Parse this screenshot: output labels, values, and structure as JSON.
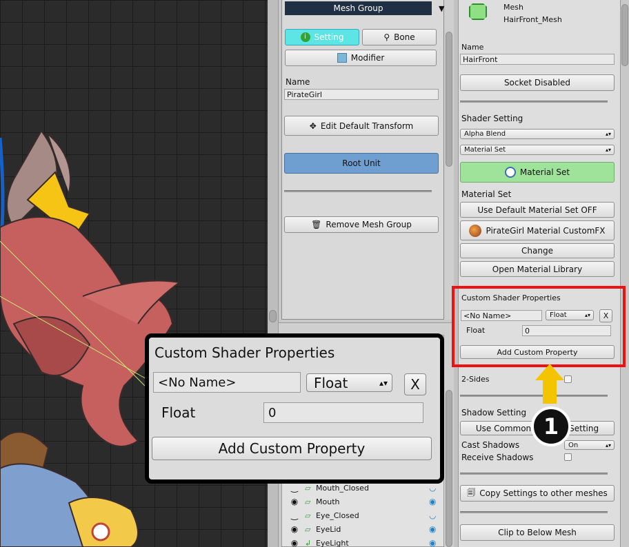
{
  "mid": {
    "mesh_group": "Mesh Group",
    "setting": "Setting",
    "bone": "Bone",
    "modifier": "Modifier",
    "name_label": "Name",
    "name_value": "PirateGirl",
    "edit_transform": "Edit Default Transform",
    "root_unit": "Root Unit",
    "remove_group": "Remove Mesh Group",
    "hierarchy": [
      {
        "name": "Mouth_Closed",
        "eye": "‿"
      },
      {
        "name": "Mouth",
        "eye": "◉"
      },
      {
        "name": "Eye_Closed",
        "eye": "‿"
      },
      {
        "name": "EyeLid",
        "eye": "◉"
      },
      {
        "name": "EyeLight",
        "eye": "◉"
      }
    ]
  },
  "right": {
    "mesh_title": "Mesh",
    "mesh_name": "HairFront_Mesh",
    "name_label": "Name",
    "name_value": "HairFront",
    "socket": "Socket Disabled",
    "shader_setting": "Shader Setting",
    "blend": "Alpha Blend",
    "material_set_drop": "Material Set",
    "material_set_btn": "Material Set",
    "material_set_label": "Material Set",
    "use_default": "Use Default Material Set OFF",
    "custom_fx": "PirateGirl Material CustomFX",
    "change": "Change",
    "open_library": "Open Material Library",
    "custom_shader": "Custom Shader Properties",
    "prop_name": "<No Name>",
    "prop_type": "Float",
    "remove_x": "X",
    "float_label": "Float",
    "float_value": "0",
    "add_property": "Add Custom Property",
    "two_sides": "2-Sides",
    "shadow_setting": "Shadow Setting",
    "use_common": "Use Common Shadow Setting",
    "cast_shadows": "Cast Shadows",
    "cast_value": "On",
    "receive_shadows": "Receive Shadows",
    "copy_settings": "Copy Settings to other meshes",
    "clip_below": "Clip to Below Mesh"
  },
  "zoom": {
    "title": "Custom Shader Properties",
    "prop_name": "<No Name>",
    "prop_type": "Float",
    "remove_x": "X",
    "float_label": "Float",
    "float_value": "0",
    "add_property": "Add Custom Property"
  },
  "badge": "1",
  "colors": {
    "highlight": "#ee1111",
    "arrow": "#f5c400",
    "setting_tab": "#5de4e4",
    "root_unit": "#6f9ed0",
    "material_btn": "#9fe39a"
  }
}
